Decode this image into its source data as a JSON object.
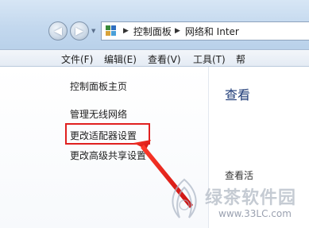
{
  "address": {
    "crumbs": [
      "控制面板",
      "网络和 Inter"
    ]
  },
  "menu": {
    "items": [
      "文件(F)",
      "编辑(E)",
      "查看(V)",
      "工具(T)",
      "帮"
    ]
  },
  "sidebar": {
    "items": [
      {
        "label": "控制面板主页"
      },
      {
        "label": "管理无线网络"
      },
      {
        "label": "更改适配器设置"
      },
      {
        "label": "更改高级共享设置"
      }
    ]
  },
  "main": {
    "heading": "查看",
    "subtext": "查看活"
  },
  "watermark": {
    "brand": "绿茶软件园",
    "url": "www.33LC.com"
  },
  "colors": {
    "highlight": "#e02020",
    "arrow": "#e02020",
    "heading": "#1f3c78"
  }
}
